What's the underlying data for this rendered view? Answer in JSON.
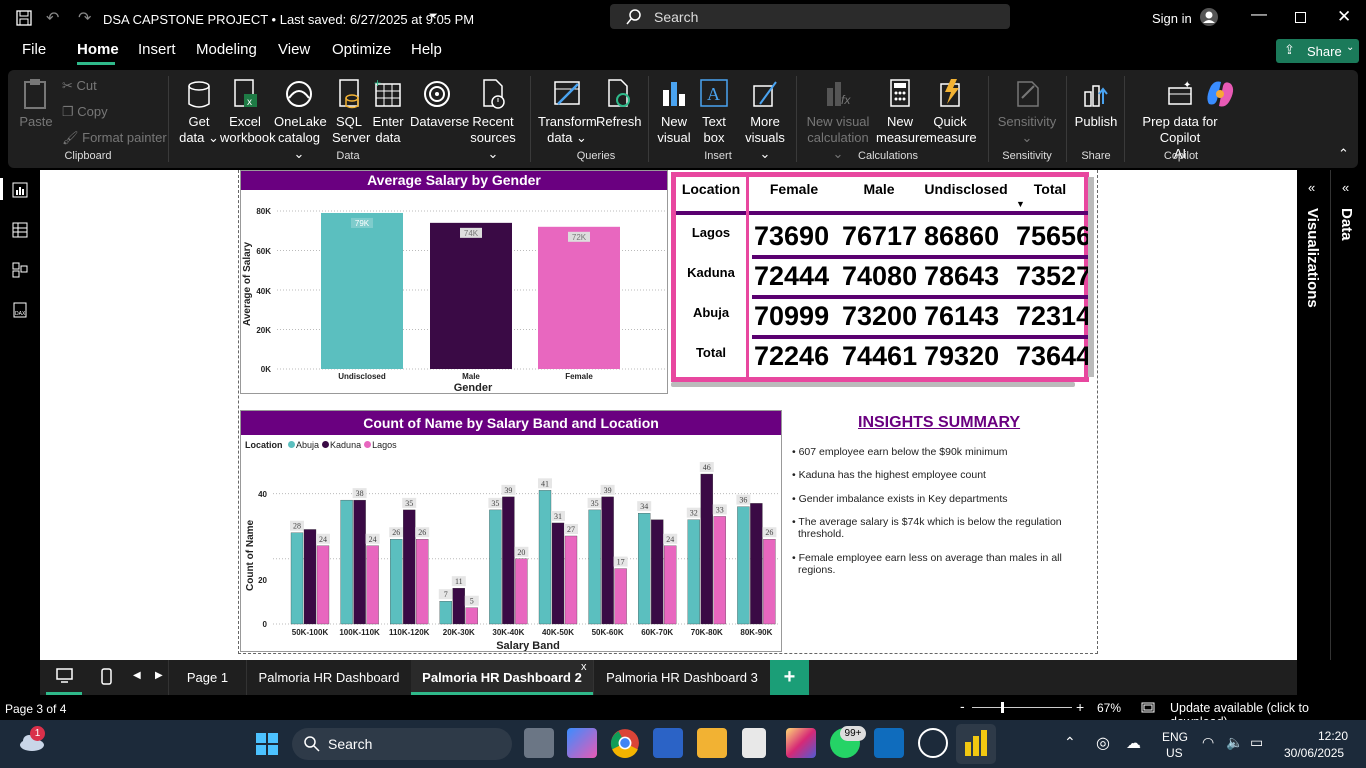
{
  "titlebar": {
    "title": "DSA CAPSTONE PROJECT • Last saved: 6/27/2025 at 9:05 PM",
    "search_placeholder": "Search",
    "signin": "Sign in"
  },
  "menu": {
    "items": [
      "File",
      "Home",
      "Insert",
      "Modeling",
      "View",
      "Optimize",
      "Help"
    ],
    "active": "Home",
    "share": "Share"
  },
  "ribbon": {
    "clipboard": {
      "paste": "Paste",
      "cut": "Cut",
      "copy": "Copy",
      "format_painter": "Format painter",
      "group": "Clipboard"
    },
    "data": {
      "get_data": [
        "Get",
        "data ⌄"
      ],
      "excel": [
        "Excel",
        "workbook"
      ],
      "onelake": [
        "OneLake",
        "catalog ⌄"
      ],
      "sql": [
        "SQL",
        "Server"
      ],
      "enter": [
        "Enter",
        "data"
      ],
      "dataverse": [
        "Dataverse",
        ""
      ],
      "recent": [
        "Recent",
        "sources ⌄"
      ],
      "group": "Data"
    },
    "queries": {
      "transform": [
        "Transform",
        "data ⌄"
      ],
      "refresh": [
        "Refresh",
        ""
      ],
      "group": "Queries"
    },
    "insert": {
      "new_visual": [
        "New",
        "visual"
      ],
      "text_box": [
        "Text",
        "box"
      ],
      "more_visuals": [
        "More",
        "visuals ⌄"
      ],
      "group": "Insert"
    },
    "calculations": {
      "new_visual_calc": [
        "New visual",
        "calculation ⌄"
      ],
      "new_measure": [
        "New",
        "measure"
      ],
      "quick_measure": [
        "Quick",
        "measure"
      ],
      "group": "Calculations"
    },
    "sensitivity": {
      "label": [
        "Sensitivity",
        "⌄"
      ],
      "group": "Sensitivity"
    },
    "share": {
      "publish": [
        "Publish",
        ""
      ],
      "group": "Share"
    },
    "copilot": {
      "prep": [
        "Prep data for Copilot",
        "AI"
      ],
      "group": "Copilot"
    }
  },
  "salary_chart": {
    "title": "Average Salary by Gender",
    "ylabel": "Average of Salary",
    "xlabel": "Gender",
    "yticks": [
      "80K",
      "60K",
      "40K",
      "20K",
      "0K"
    ]
  },
  "matrix": {
    "headers": [
      "Location",
      "Female",
      "Male",
      "Undisclosed",
      "Total"
    ],
    "rows": [
      {
        "label": "Lagos",
        "values": [
          "73690",
          "76717",
          "86860",
          "75656"
        ]
      },
      {
        "label": "Kaduna",
        "values": [
          "72444",
          "74080",
          "78643",
          "73527"
        ]
      },
      {
        "label": "Abuja",
        "values": [
          "70999",
          "73200",
          "76143",
          "72314"
        ]
      },
      {
        "label": "Total",
        "values": [
          "72246",
          "74461",
          "79320",
          "73644"
        ]
      }
    ]
  },
  "band_chart": {
    "title": "Count of Name by Salary Band and Location",
    "legend_title": "Location",
    "ylabel": "Count of Name",
    "xlabel": "Salary Band",
    "yticks": [
      "40",
      "20",
      "0"
    ]
  },
  "insights": {
    "title": "INSIGHTS SUMMARY",
    "items": [
      "607 employee earn below the $90k minimum",
      "Kaduna has the highest employee count",
      "Gender imbalance  exists in Key departments",
      "The average salary is  $74k which is below the regulation threshold.",
      "Female employee earn less on average than males in all regions."
    ]
  },
  "right_panes": {
    "visualizations": "Visualizations",
    "data": "Data"
  },
  "pages": {
    "tabs": [
      "Page 1",
      "Palmoria HR Dashboard",
      "Palmoria HR Dashboard 2",
      "Palmoria HR Dashboard 3"
    ],
    "active": "Palmoria HR Dashboard 2",
    "add": "+"
  },
  "status": {
    "page": "Page 3 of 4",
    "zoom": "67%",
    "update": "Update available (click to download)"
  },
  "taskbar": {
    "search": "Search",
    "lang": "ENG",
    "region": "US",
    "time": "12:20",
    "date": "30/06/2025",
    "badge_weather": "1",
    "badge_whatsapp": "99+"
  },
  "colors": {
    "purple_header": "#6a0080",
    "undisclosed": "#5bbfbf",
    "male": "#3a0a45",
    "female": "#e867bf",
    "matrix_border": "#e8479f",
    "share_btn": "#1b7a5a"
  },
  "chart_data": [
    {
      "type": "bar",
      "title": "Average Salary by Gender",
      "xlabel": "Gender",
      "ylabel": "Average of Salary",
      "categories": [
        "Undisclosed",
        "Male",
        "Female"
      ],
      "values": [
        79000,
        74000,
        72000
      ],
      "labels": [
        "79K",
        "74K",
        "72K"
      ],
      "ylim": [
        0,
        80000
      ],
      "colors": [
        "#5bbfbf",
        "#3a0a45",
        "#e867bf"
      ]
    },
    {
      "type": "bar",
      "title": "Count of Name by Salary Band and Location",
      "xlabel": "Salary Band",
      "ylabel": "Count of Name",
      "legend_title": "Location",
      "categories": [
        "50K-100K",
        "100K-110K",
        "110K-120K",
        "20K-30K",
        "30K-40K",
        "40K-50K",
        "50K-60K",
        "60K-70K",
        "70K-80K",
        "80K-90K"
      ],
      "series": [
        {
          "name": "Abuja",
          "color": "#5bbfbf",
          "values": [
            28,
            38,
            26,
            7,
            35,
            41,
            35,
            34,
            32,
            36
          ]
        },
        {
          "name": "Kaduna",
          "color": "#3a0a45",
          "values": [
            29,
            38,
            35,
            11,
            39,
            31,
            39,
            32,
            46,
            37
          ]
        },
        {
          "name": "Lagos",
          "color": "#e867bf",
          "values": [
            24,
            24,
            26,
            5,
            20,
            27,
            17,
            24,
            33,
            26
          ]
        }
      ],
      "labels": {
        "Abuja": [
          "28",
          null,
          "26",
          "7",
          "35",
          "41",
          "35",
          "34",
          "32",
          "36"
        ],
        "Kaduna": [
          null,
          "38",
          "35",
          "11",
          "39",
          "31",
          "39",
          null,
          "46",
          null
        ],
        "Lagos": [
          "24",
          "24",
          "26",
          "5",
          "20",
          "27",
          "17",
          "24",
          "33",
          "26"
        ]
      },
      "ylim": [
        0,
        50
      ]
    }
  ]
}
